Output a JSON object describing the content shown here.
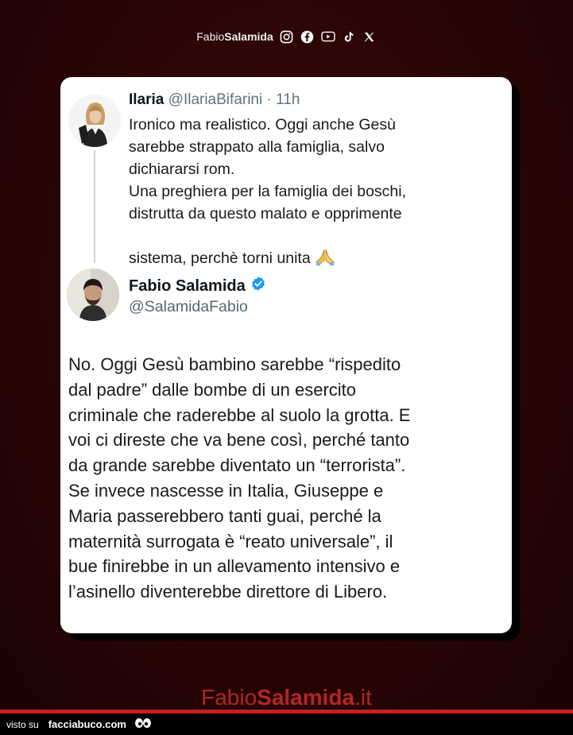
{
  "header": {
    "brand_regular": "Fabio",
    "brand_bold": "Salamida",
    "social_icons": [
      "instagram-icon",
      "facebook-icon",
      "youtube-icon",
      "tiktok-icon",
      "x-icon"
    ]
  },
  "reply_tweet": {
    "name": "Ilaria",
    "handle": "@IlariaBifarini",
    "separator": " · ",
    "time": "11h",
    "text": "Ironico ma realistico. Oggi anche Gesù\nsarebbe strappato alla famiglia, salvo\ndichiararsi rom.\nUna preghiera per la famiglia dei boschi,\ndistrutta da questo malato e opprimente\nsistema, perchè torni unita",
    "emoji": "🙏"
  },
  "main_tweet": {
    "name": "Fabio Salamida",
    "verified": true,
    "handle": "@SalamidaFabio",
    "text": "No. Oggi Gesù bambino sarebbe “rispedito\ndal padre” dalle bombe di un esercito\ncriminale che raderebbe al suolo la grotta. E\nvoi ci direste che va bene così, perché tanto\nda grande sarebbe diventato un “terrorista”.\nSe invece nascesse in Italia, Giuseppe e\nMaria passerebbero tanti guai, perché la\nmaternità surrogata è “reato universale”, il\nbue finirebbe in un allevamento intensivo e\nl’asinello diventerebbe direttore di Libero."
  },
  "footer": {
    "brand_regular": "Fabio",
    "brand_bold": "Salamida",
    "brand_tld": ".it"
  },
  "bottom_bar": {
    "prefix": "visto su",
    "site": "facciabuco.com"
  },
  "colors": {
    "background": "#2a0606",
    "footer_brand": "#b52525",
    "verified_badge": "#1d9bf0"
  }
}
